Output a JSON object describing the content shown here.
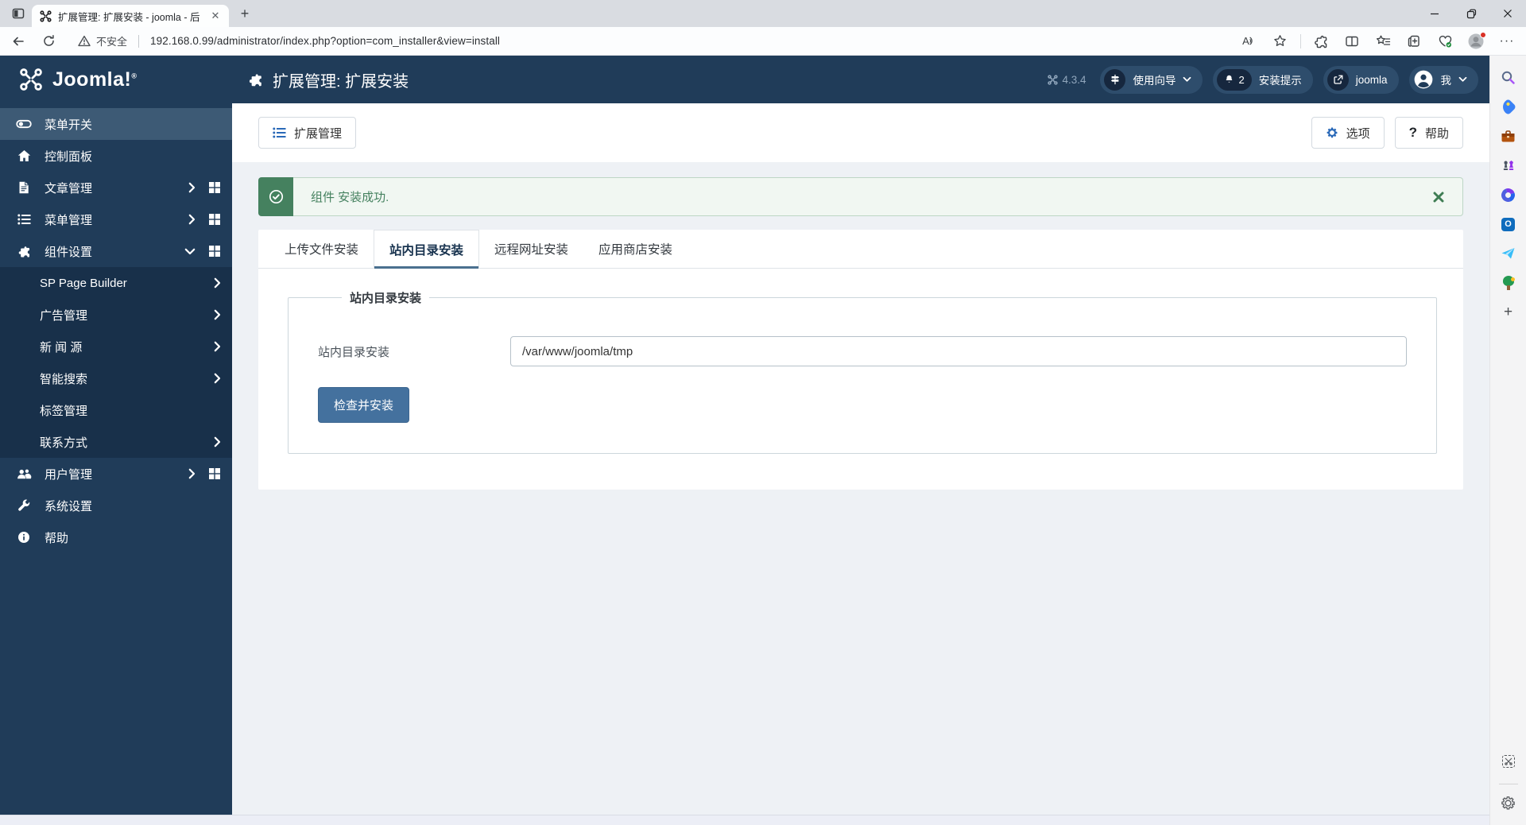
{
  "browser": {
    "tab_title": "扩展管理: 扩展安装 - joomla - 后",
    "new_tab_glyph": "+",
    "security_label": "不安全",
    "url": "192.168.0.99/administrator/index.php?option=com_installer&view=install",
    "readaloud_glyph": "A",
    "more_glyph": "···"
  },
  "jheader": {
    "logo_text": "Joomla!",
    "page_title": "扩展管理: 扩展安装",
    "version": "4.3.4",
    "guide_label": "使用向导",
    "messages_count": "2",
    "messages_label": "安装提示",
    "site_label": "joomla",
    "account_label": "我"
  },
  "sidebar": {
    "items": [
      {
        "label": "菜单开关"
      },
      {
        "label": "控制面板"
      },
      {
        "label": "文章管理"
      },
      {
        "label": "菜单管理"
      },
      {
        "label": "组件设置"
      },
      {
        "label": "SP Page Builder"
      },
      {
        "label": "广告管理"
      },
      {
        "label": "新 闻 源"
      },
      {
        "label": "智能搜索"
      },
      {
        "label": "标签管理"
      },
      {
        "label": "联系方式"
      },
      {
        "label": "用户管理"
      },
      {
        "label": "系统设置"
      },
      {
        "label": "帮助"
      }
    ]
  },
  "toolbar": {
    "extensions_label": "扩展管理",
    "options_label": "选项",
    "help_label": "帮助",
    "help_glyph": "?"
  },
  "alert": {
    "message": "组件 安装成功."
  },
  "tabs": {
    "active_index": 1,
    "items": [
      {
        "label": "上传文件安装"
      },
      {
        "label": "站内目录安装"
      },
      {
        "label": "远程网址安装"
      },
      {
        "label": "应用商店安装"
      }
    ]
  },
  "form": {
    "legend": "站内目录安装",
    "field_label": "站内目录安装",
    "field_value": "/var/www/joomla/tmp",
    "submit_label": "检查并安装"
  },
  "edge_rail": {
    "icons": [
      "search",
      "shopping",
      "toolbox",
      "games",
      "microsoft-365",
      "outlook",
      "drop",
      "tree",
      "add",
      "web-capture",
      "settings"
    ]
  },
  "colors": {
    "navy": "#203c59",
    "active_item": "#3d5a75",
    "submenu": "#18304a",
    "success_dark": "#45815f",
    "success_bg": "#f1f7f2",
    "primary_button": "#44719e",
    "accent_blue": "#2a69b8",
    "tab_underline": "#4a708f"
  }
}
